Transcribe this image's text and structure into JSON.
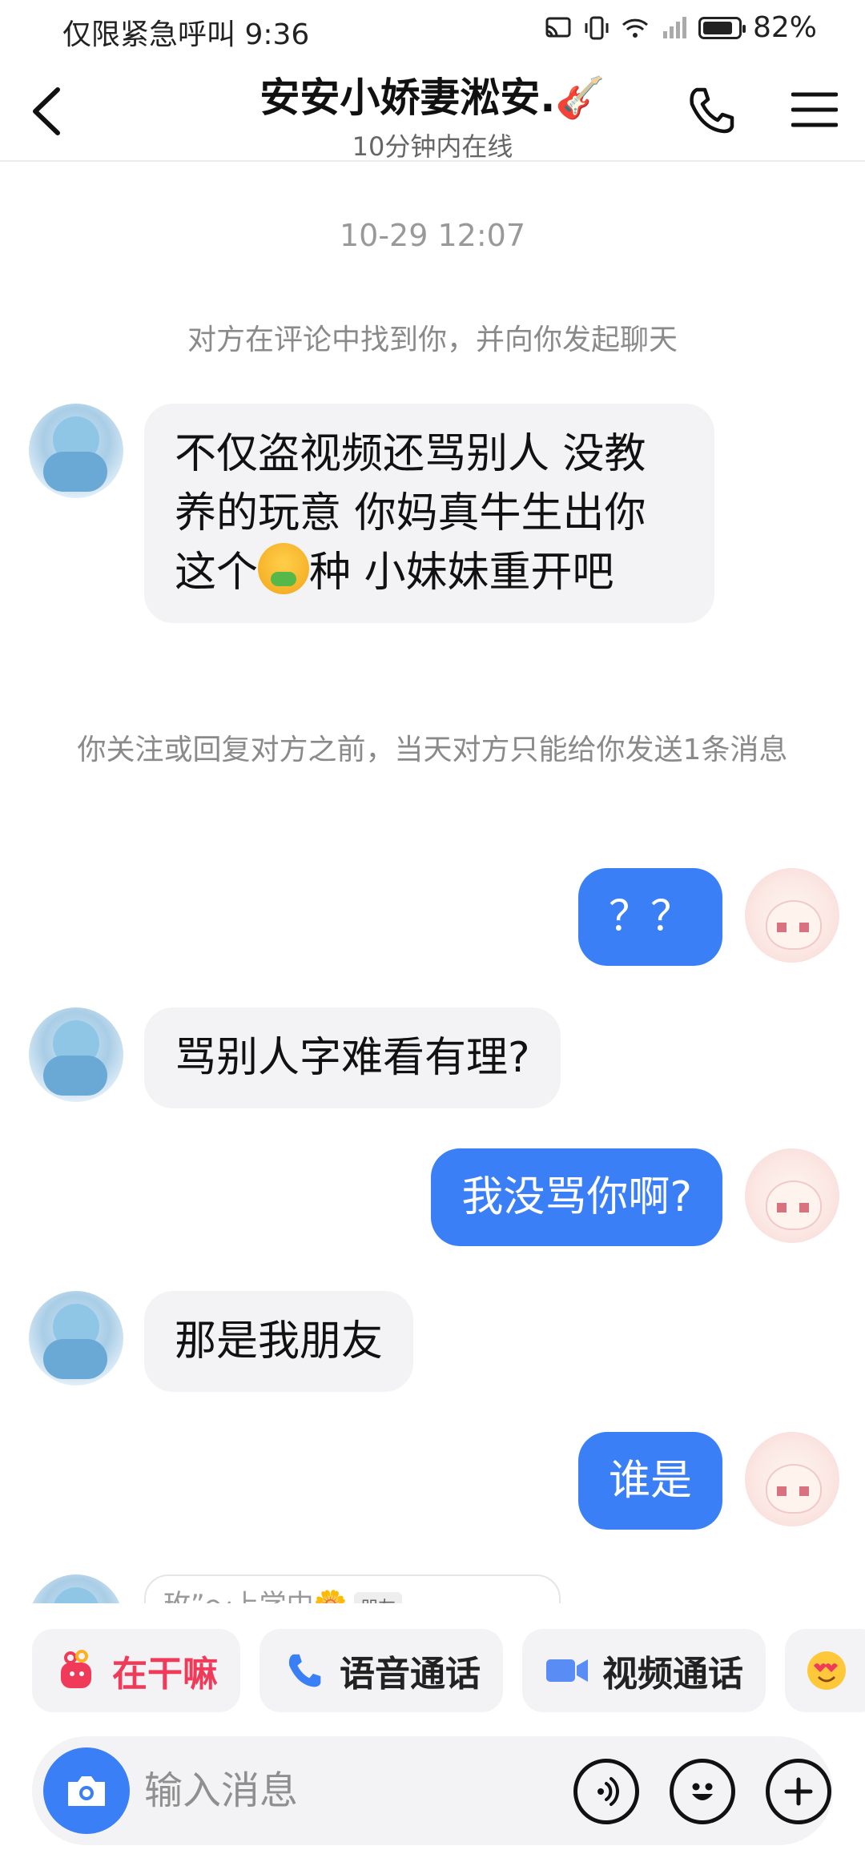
{
  "status_bar": {
    "left_text": "仅限紧急呼叫 9:36",
    "battery_text": "82%",
    "battery_level": 0.82
  },
  "header": {
    "title": "安安小娇妻淞安.🎸",
    "subtitle": "10分钟内在线"
  },
  "chat": {
    "time_label": "10-29 12:07",
    "system_messages": [
      "对方在评论中找到你，并向你发起聊天",
      "你关注或回复对方之前，当天对方只能给你发送1条消息"
    ],
    "messages": [
      {
        "side": "left",
        "text_before": "不仅盗视频还骂别人 没教养的玩意 你妈真牛生出你这个",
        "emoji": "nauseated-face",
        "text_after": "种 小妹妹重开吧"
      },
      {
        "side": "right",
        "text": "？？"
      },
      {
        "side": "left",
        "text": "骂别人字难看有理?"
      },
      {
        "side": "right",
        "text": "我没骂你啊?"
      },
      {
        "side": "left",
        "text": "那是我朋友"
      },
      {
        "side": "right",
        "text": "谁是"
      }
    ],
    "partial_preview": {
      "text": "玫”～上学中🌼",
      "tag": "朋友"
    }
  },
  "quick_actions": [
    {
      "label": "在干嘛",
      "icon": "wave-hand-icon"
    },
    {
      "label": "语音通话",
      "icon": "phone-icon"
    },
    {
      "label": "视频通话",
      "icon": "video-camera-icon"
    },
    {
      "label": "",
      "icon": "heart-eyes-emoji-icon"
    }
  ],
  "input_bar": {
    "placeholder": "输入消息"
  },
  "colors": {
    "accent_blue": "#3a7ff5",
    "bubble_gray": "#f3f3f5",
    "chip_red": "#f03a5a"
  }
}
